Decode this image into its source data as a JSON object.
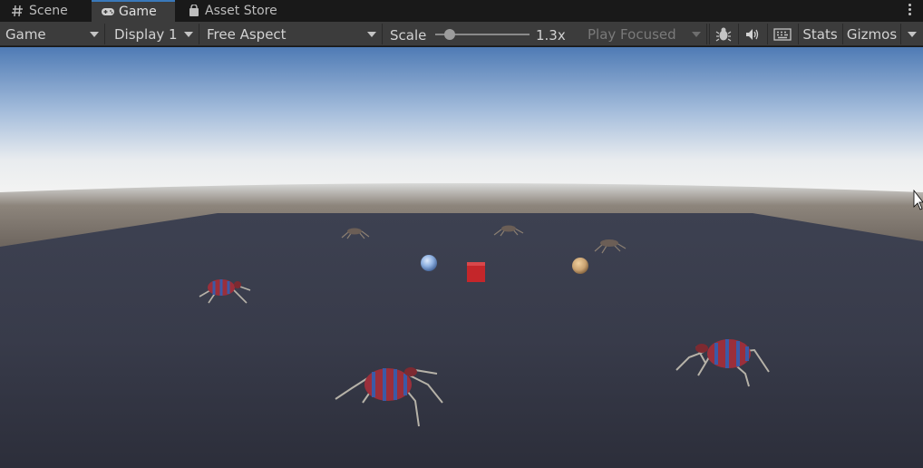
{
  "tabs": [
    {
      "label": "Scene",
      "icon": "hash-icon"
    },
    {
      "label": "Game",
      "icon": "gamepad-icon",
      "active": true
    },
    {
      "label": "Asset Store",
      "icon": "shopping-bag-icon"
    }
  ],
  "toolbar": {
    "view_mode": "Game",
    "display": "Display 1",
    "aspect": "Free Aspect",
    "scale_label": "Scale",
    "scale_value": "1.3x",
    "play_mode": "Play Focused",
    "stats_label": "Stats",
    "gizmos_label": "Gizmos",
    "icons": [
      "bug-icon",
      "audio-icon",
      "keyboard-icon",
      "kebab-menu-icon"
    ]
  },
  "scene": {
    "objects": [
      "red-cube",
      "blue-sphere",
      "tan-sphere",
      "spider-enemies"
    ],
    "colors": {
      "sky_top": "#4f7bb5",
      "horizon": "#e9ecef",
      "ground_far": "#7a6e62",
      "plane": "#3a3d4c",
      "cube": "#c4262a",
      "blue_sphere": "#8fb1e1",
      "tan_sphere": "#c9a271",
      "spider_body": "#9b2f3b",
      "spider_stripe": "#3b5aa7",
      "spider_legs": "#b6b2a8"
    }
  }
}
